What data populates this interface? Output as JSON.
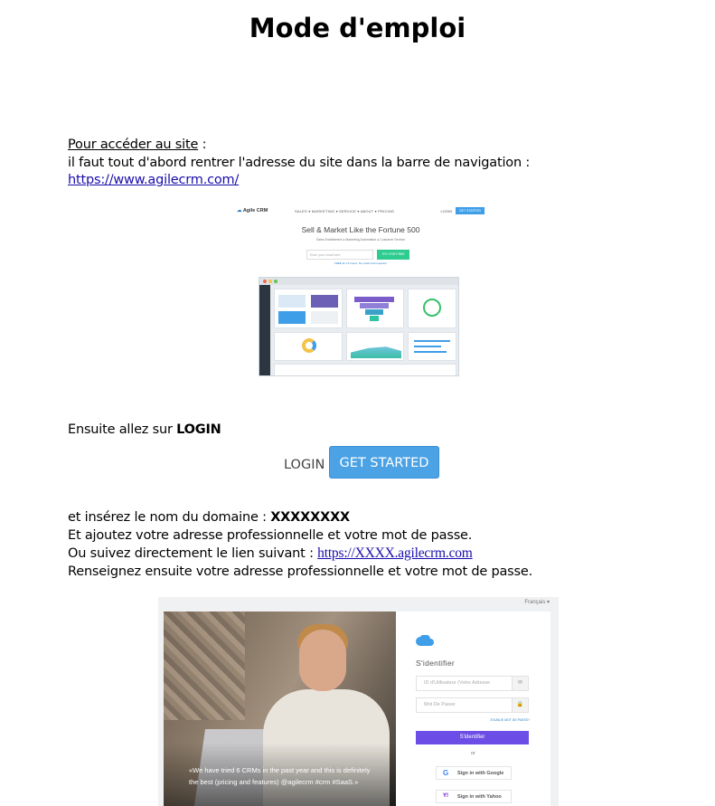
{
  "title": "Mode d'emploi",
  "intro": {
    "heading": "Pour accéder au site",
    "heading_suffix": " :",
    "line2": "il faut tout d'abord rentrer l'adresse du site dans la barre de navigation :",
    "url": "https://www.agilecrm.com/"
  },
  "site_screenshot": {
    "logo": "Agile CRM",
    "menu": "SALES ▾    MARKETING ▾    SERVICE ▾    ABOUT ▾    PRICING",
    "login": "LOGIN",
    "get_started": "GET STARTED",
    "headline": "Sell & Market Like the Fortune 500",
    "subline": "Sales Enablement ● Marketing Automation ● Customer Service",
    "email_placeholder": "Enter your email here",
    "try_button": "TRY FOR FREE",
    "free_note": "FREE for 10 Users. No credit card required."
  },
  "step2": {
    "prefix": "Ensuite allez sur ",
    "bold": "LOGIN"
  },
  "buttons": {
    "login": "LOGIN",
    "get_started": "GET STARTED"
  },
  "step3": {
    "line1_prefix": "et insérez le nom du domaine : ",
    "line1_bold": "XXXXXXXX",
    "line2": "Et ajoutez votre adresse professionnelle et votre mot de passe.",
    "line3_prefix": "Ou suivez directement le lien suivant : ",
    "line3_link": "https://XXXX.agilecrm.com",
    "line4": "Renseignez ensuite votre adresse professionnelle et votre mot de passe."
  },
  "login_screenshot": {
    "language": "Français ▾",
    "title": "S'identifier",
    "user_placeholder": "ID d'Utilisateur (Votre Adresse",
    "password_placeholder": "Mot De Passe",
    "forgot": "J'OUBLIE MOT DE PASSE?",
    "submit": "S'identifier",
    "or": "or",
    "google": "Sign in with Google",
    "yahoo": "Sign in with Yahoo",
    "quote_line1": "«We have tried 6 CRMs in the past year and this is definitely",
    "quote_line2": "the best (pricing and features) @agilecrm #crm #SaaS.»"
  }
}
